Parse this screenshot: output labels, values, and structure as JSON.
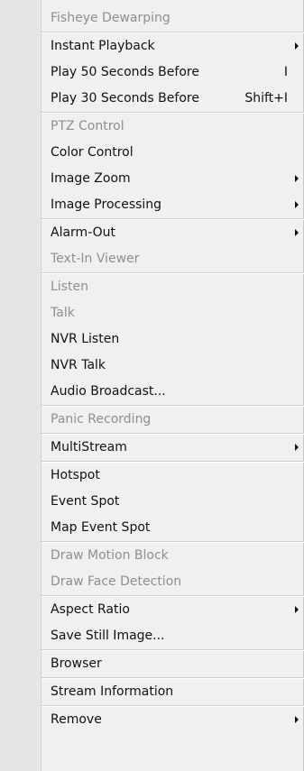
{
  "menu": {
    "items": [
      {
        "label": "Fisheye Dewarping",
        "enabled": false
      },
      {
        "label": "Instant Playback",
        "submenu": true
      },
      {
        "label": "Play 50 Seconds Before",
        "shortcut": "I"
      },
      {
        "label": "Play 30 Seconds Before",
        "shortcut": "Shift+I"
      },
      {
        "label": "PTZ Control",
        "enabled": false
      },
      {
        "label": "Color Control"
      },
      {
        "label": "Image Zoom",
        "submenu": true
      },
      {
        "label": "Image Processing",
        "submenu": true
      },
      {
        "label": "Alarm-Out",
        "submenu": true
      },
      {
        "label": "Text-In Viewer",
        "enabled": false
      },
      {
        "label": "Listen",
        "enabled": false
      },
      {
        "label": "Talk",
        "enabled": false
      },
      {
        "label": "NVR Listen"
      },
      {
        "label": "NVR Talk"
      },
      {
        "label": "Audio Broadcast..."
      },
      {
        "label": "Panic Recording",
        "enabled": false
      },
      {
        "label": "MultiStream",
        "submenu": true
      },
      {
        "label": "Hotspot"
      },
      {
        "label": "Event Spot"
      },
      {
        "label": "Map Event Spot"
      },
      {
        "label": "Draw Motion Block",
        "enabled": false
      },
      {
        "label": "Draw Face Detection",
        "enabled": false
      },
      {
        "label": "Aspect Ratio",
        "submenu": true
      },
      {
        "label": "Save Still Image..."
      },
      {
        "label": "Browser"
      },
      {
        "label": "Stream Information"
      },
      {
        "label": "Remove",
        "submenu": true
      }
    ]
  }
}
